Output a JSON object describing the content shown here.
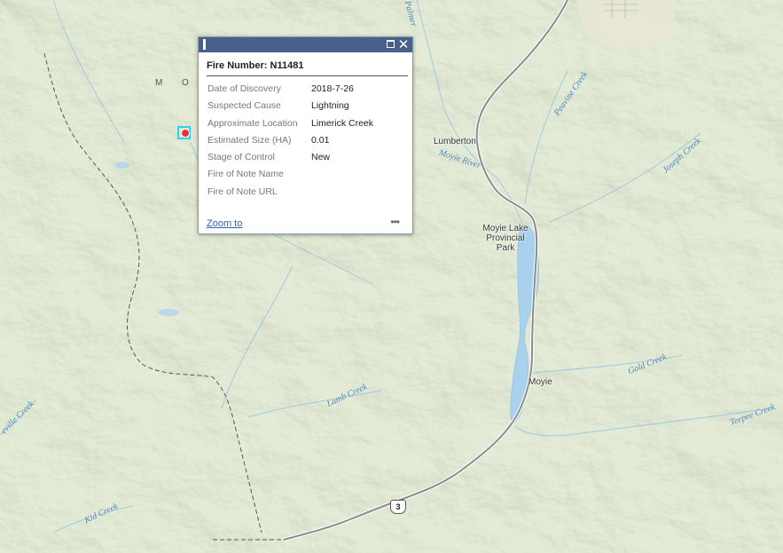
{
  "popup": {
    "title": "Fire Number: N11481",
    "attributes": [
      {
        "key": "Date of Discovery",
        "value": "2018-7-26"
      },
      {
        "key": "Suspected Cause",
        "value": "Lightning"
      },
      {
        "key": "Approximate Location",
        "value": "Limerick Creek"
      },
      {
        "key": "Estimated Size (HA)",
        "value": "0.01"
      },
      {
        "key": "Stage of Control",
        "value": "New"
      },
      {
        "key": "Fire of Note Name",
        "value": ""
      },
      {
        "key": "Fire of Note URL",
        "value": ""
      }
    ],
    "zoom_label": "Zoom to",
    "more_label": "•••",
    "close_label": "✕"
  },
  "map": {
    "places": {
      "lumberton": "Lumberton",
      "moyie": "Moyie",
      "park_line1": "Moyie Lake",
      "park_line2": "Provincial",
      "park_line3": "Park",
      "mountain_letter1": "M",
      "mountain_letter2": "O"
    },
    "creeks": {
      "moyie_river": "Moyie River",
      "peavine": "Peavine Creek",
      "joseph": "Joseph Creek",
      "gold": "Gold Creek",
      "teepee": "Teepee Creek",
      "lamb": "Lamb Creek",
      "kid": "Kid Creek",
      "left_edge": "eville Creek",
      "top_partial": "Palmer"
    },
    "highway_shield": "3",
    "colors": {
      "land": "#e3ebd6",
      "water": "#a9d0ec",
      "road": "#8a8a8a",
      "boundary": "#555555",
      "popup_header": "#47618c",
      "marker": "#e8303a",
      "marker_highlight": "#33d0e6"
    }
  }
}
